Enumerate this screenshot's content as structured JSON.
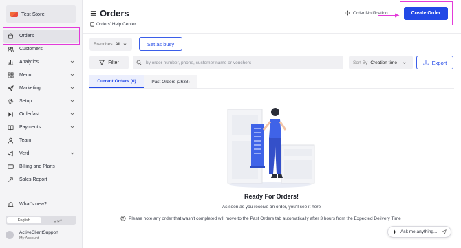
{
  "colors": {
    "accent": "#2249e6",
    "annotation": "#e33bd9",
    "sidebar_bg": "#f4f4f6"
  },
  "sidebar": {
    "store_name": "Test Store",
    "items": [
      {
        "label": "Orders",
        "icon": "shopping-bag-icon",
        "active": true,
        "expandable": false
      },
      {
        "label": "Customers",
        "icon": "users-icon",
        "expandable": false
      },
      {
        "label": "Analytics",
        "icon": "bar-chart-icon",
        "expandable": true
      },
      {
        "label": "Menu",
        "icon": "grid-icon",
        "expandable": true
      },
      {
        "label": "Marketing",
        "icon": "send-icon",
        "expandable": true
      },
      {
        "label": "Setup",
        "icon": "gear-icon",
        "expandable": true
      },
      {
        "label": "Orderfast",
        "icon": "media-icon",
        "expandable": true
      },
      {
        "label": "Payments",
        "icon": "book-icon",
        "expandable": true
      },
      {
        "label": "Team",
        "icon": "user-icon",
        "expandable": false
      },
      {
        "label": "Verd",
        "icon": "megaphone-icon",
        "expandable": true
      },
      {
        "label": "Billing and Plans",
        "icon": "card-icon",
        "expandable": false
      },
      {
        "label": "Sales Report",
        "icon": "trend-icon",
        "expandable": false
      }
    ],
    "whats_new": "What's new?",
    "language": {
      "options": [
        "English",
        "عربي"
      ],
      "selected": "English"
    },
    "account": {
      "name": "ActiveClientSupport",
      "link": "My Account"
    }
  },
  "header": {
    "title": "Orders",
    "help_link": "Orders' Help Center",
    "notification_label": "Order Notification",
    "create_button": "Create Order"
  },
  "toolbar": {
    "branches_label": "Branches",
    "branches_value": "All",
    "busy_button": "Set as busy",
    "filter_button": "Filter",
    "search_placeholder": "by order number, phone, customer name or vouchers",
    "sort_label": "Sort By",
    "sort_value": "Creation time",
    "export_button": "Export"
  },
  "tabs": [
    {
      "label": "Current Orders (0)",
      "active": true
    },
    {
      "label": "Past Orders (2638)",
      "active": false
    }
  ],
  "empty_state": {
    "title": "Ready For Orders!",
    "subtitle": "As soon as you receive an order, you'll see it here",
    "note": "Please note any order that wasn't completed will move to the Past Orders tab automatically after 3 hours from the Expected Delivery Time"
  },
  "assistant": {
    "placeholder": "Ask me anything..."
  }
}
